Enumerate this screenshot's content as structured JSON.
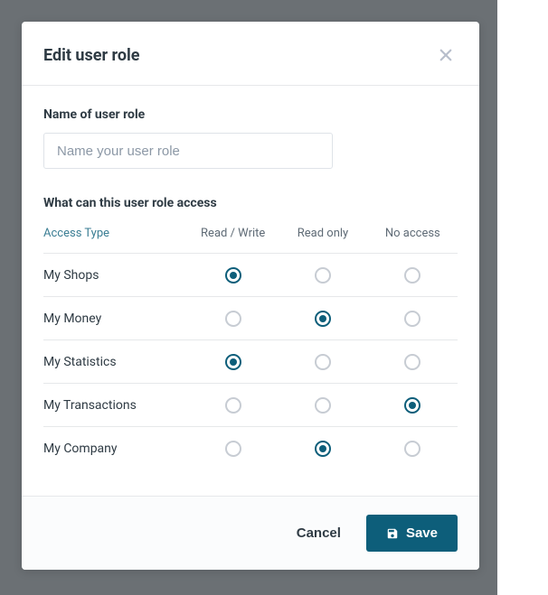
{
  "modal": {
    "title": "Edit user role",
    "name_field": {
      "label": "Name of user role",
      "placeholder": "Name your user role",
      "value": ""
    },
    "access_section": {
      "label": "What can this user role access",
      "columns": {
        "type": "Access Type",
        "rw": "Read / Write",
        "ro": "Read only",
        "na": "No access"
      },
      "rows": [
        {
          "label": "My Shops",
          "selected": "rw"
        },
        {
          "label": "My Money",
          "selected": "ro"
        },
        {
          "label": "My Statistics",
          "selected": "rw"
        },
        {
          "label": "My Transactions",
          "selected": "na"
        },
        {
          "label": "My Company",
          "selected": "ro"
        }
      ]
    },
    "footer": {
      "cancel": "Cancel",
      "save": "Save"
    }
  }
}
